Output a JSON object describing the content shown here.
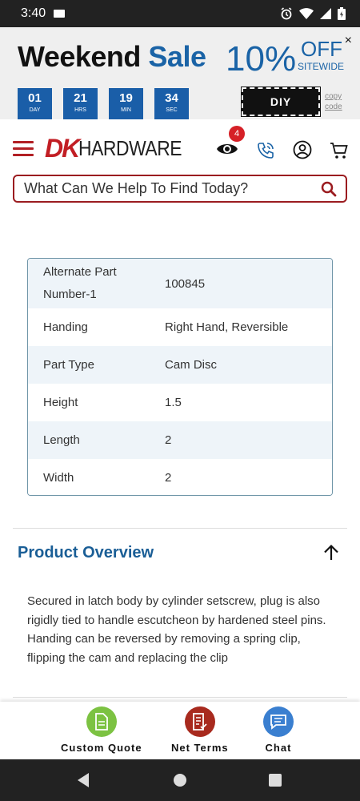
{
  "status_bar": {
    "time": "3:40"
  },
  "promo": {
    "title_part1": "Weekend",
    "title_part2": "Sale",
    "percent": "10%",
    "off": "OFF",
    "sitewide": "SITEWIDE",
    "close": "×",
    "countdown": [
      {
        "value": "01",
        "label": "DAY"
      },
      {
        "value": "21",
        "label": "HRS"
      },
      {
        "value": "19",
        "label": "MIN"
      },
      {
        "value": "34",
        "label": "SEC"
      }
    ],
    "coupon_code": "DIY",
    "copy_line1": "copy",
    "copy_line2": "code"
  },
  "header": {
    "logo_dk": "DK",
    "logo_hardware": "HARDWARE",
    "recently_viewed_count": "4"
  },
  "search": {
    "placeholder": "What Can We Help To Find Today?"
  },
  "specs": [
    {
      "key": "Alternate Part Number-1",
      "value": "100845"
    },
    {
      "key": "Handing",
      "value": "Right Hand, Reversible"
    },
    {
      "key": "Part Type",
      "value": "Cam Disc"
    },
    {
      "key": "Height",
      "value": "1.5"
    },
    {
      "key": "Length",
      "value": "2"
    },
    {
      "key": "Width",
      "value": "2"
    }
  ],
  "overview": {
    "title": "Product Overview",
    "text": "Secured in latch body by cylinder setscrew, plug is also rigidly tied to handle escutcheon by hardened steel pins. Handing can be reversed by removing a spring clip, flipping the cam and replacing the clip"
  },
  "actions": {
    "custom_quote": "Custom Quote",
    "net_terms": "Net Terms",
    "chat": "Chat"
  },
  "colors": {
    "brand_red": "#c21e24",
    "brand_blue": "#1a63a6",
    "quote_green": "#7cc242",
    "terms_red": "#a82a1e",
    "chat_blue": "#3a7fd0"
  }
}
